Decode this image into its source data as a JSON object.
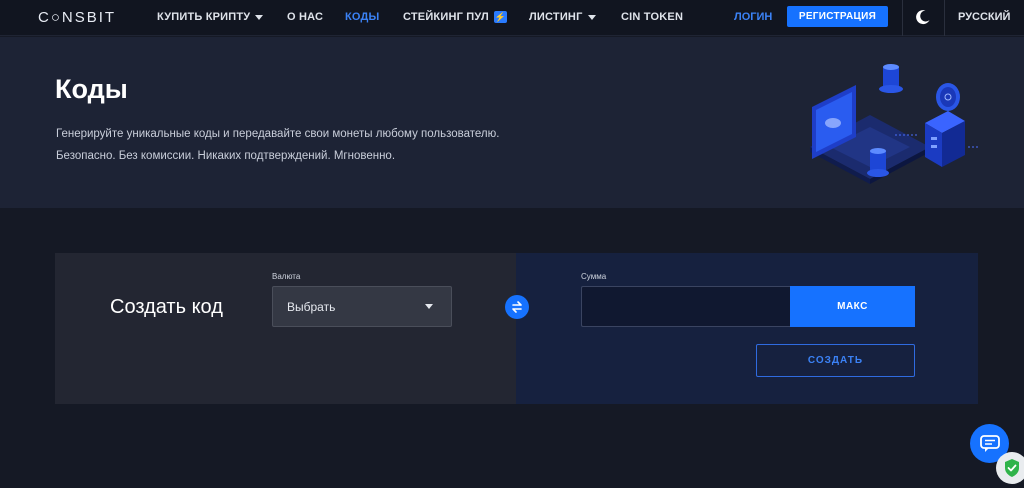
{
  "nav": {
    "logo": "C○NSBIT",
    "items": [
      {
        "label": "КУПИТЬ КРИПТУ",
        "dropdown": true
      },
      {
        "label": "О НАС"
      },
      {
        "label": "КОДЫ",
        "active": true
      },
      {
        "label": "СТЕЙКИНГ ПУЛ",
        "icon": "bolt-icon"
      },
      {
        "label": "ЛИСТИНГ",
        "dropdown": true
      },
      {
        "label": "CIN TOKEN"
      }
    ],
    "login": "ЛОГИН",
    "register": "РЕГИСТРАЦИЯ",
    "language": "РУССКИЙ",
    "theme_icon": "moon-icon"
  },
  "hero": {
    "title": "Коды",
    "line1": "Генерируйте уникальные коды и передавайте свои монеты любому пользователю.",
    "line2": "Безопасно. Без комиссии. Никаких подтверждений. Мгновенно."
  },
  "form": {
    "title": "Создать код",
    "currency_label": "Валюта",
    "currency_value": "Выбрать",
    "amount_label": "Сумма",
    "amount_value": "",
    "max_label": "МАКС",
    "create_label": "СОЗДАТЬ"
  },
  "colors": {
    "accent": "#1672ff",
    "nav_bg": "#111520",
    "hero_bg": "#1d2335",
    "page_bg": "#151925",
    "card_left_bg": "#232632",
    "card_right_bg": "#16213f"
  }
}
